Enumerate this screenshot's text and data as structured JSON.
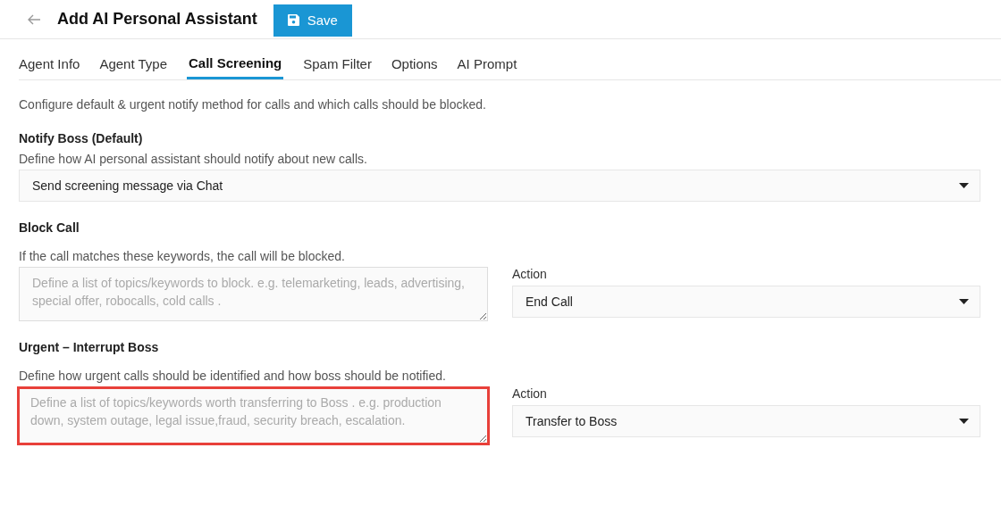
{
  "header": {
    "title": "Add AI Personal Assistant",
    "save_button": "Save"
  },
  "tabs": [
    {
      "label": "Agent Info",
      "selected": false
    },
    {
      "label": "Agent Type",
      "selected": false
    },
    {
      "label": "Call Screening",
      "selected": true
    },
    {
      "label": "Spam Filter",
      "selected": false
    },
    {
      "label": "Options",
      "selected": false
    },
    {
      "label": "AI Prompt",
      "selected": false
    }
  ],
  "description": "Configure default & urgent notify method for calls and which calls should be blocked.",
  "sections": [
    {
      "title": "Notify Boss (Default)",
      "subtitle": "Define how AI personal assistant should notify about new calls.",
      "field": {
        "kind": "select",
        "value": "Send screening message via Chat"
      }
    },
    {
      "title": "Block Call",
      "subtitle": "If the call matches these keywords, the call will be blocked.",
      "field": {
        "kind": "textarea",
        "placeholder": "Define a list of topics/keywords to block. e.g. telemarketing, leads, advertising, special offer, robocalls, cold calls .",
        "highlighted": false
      },
      "action": {
        "label": "Action",
        "value": "End Call"
      }
    },
    {
      "title": "Urgent – Interrupt Boss",
      "subtitle": "Define how urgent calls should be identified and how boss should be notified.",
      "field": {
        "kind": "textarea",
        "placeholder": "Define a list of topics/keywords worth transferring to Boss . e.g. production down, system outage, legal issue,fraud, security breach, escalation.",
        "highlighted": true
      },
      "action": {
        "label": "Action",
        "value": "Transfer to Boss"
      }
    }
  ]
}
